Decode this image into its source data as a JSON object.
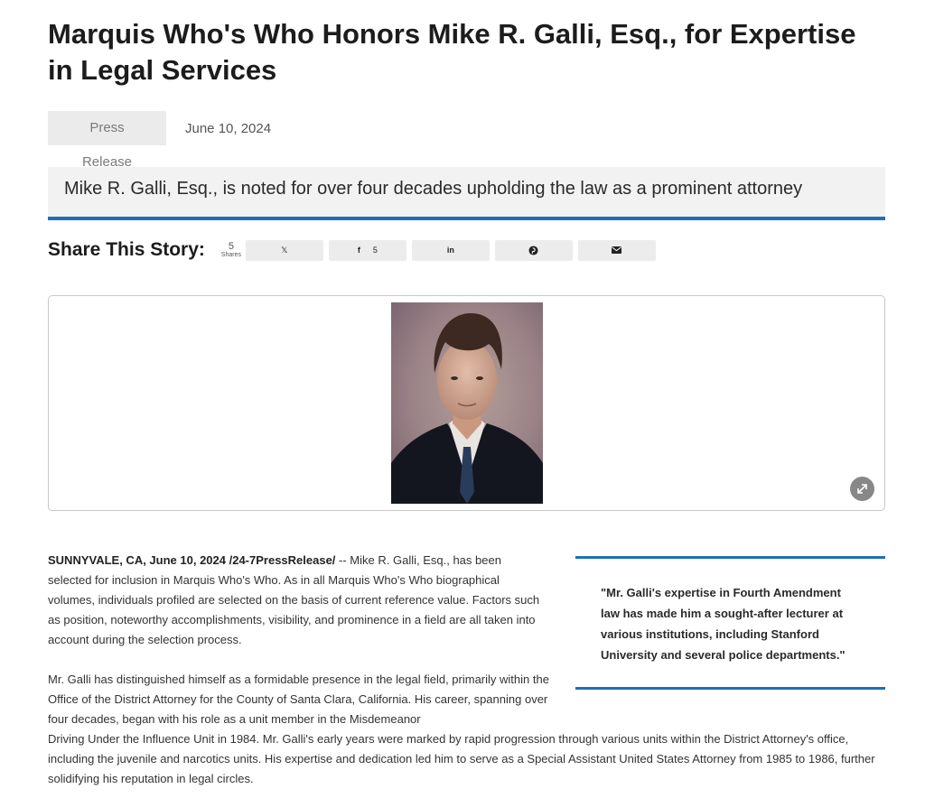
{
  "article": {
    "title": "Marquis Who's Who Honors Mike R. Galli, Esq., for Expertise in Legal Services",
    "category": "Press Release",
    "date": "June 10, 2024",
    "subtitle": "Mike R. Galli, Esq., is noted for over four decades upholding the law as a prominent attorney"
  },
  "share": {
    "heading": "Share This Story:",
    "count": "5",
    "count_label": "Shares",
    "buttons": [
      {
        "icon": "x-icon",
        "label": "𝕏",
        "count": ""
      },
      {
        "icon": "facebook-icon",
        "label": "f",
        "count": "5"
      },
      {
        "icon": "linkedin-icon",
        "label": "in",
        "count": ""
      },
      {
        "icon": "pinterest-icon",
        "label": "",
        "count": ""
      },
      {
        "icon": "email-icon",
        "label": "",
        "count": ""
      }
    ]
  },
  "figure": {
    "image": "portrait-photo",
    "expand_icon": "expand-icon"
  },
  "body": {
    "dateline": "SUNNYVALE, CA, June 10, 2024 /24-7PressRelease/",
    "p1": " -- Mike R. Galli, Esq., has been selected for inclusion in Marquis Who's Who. As in all Marquis Who's Who biographical volumes, individuals profiled are selected on the basis of current reference value. Factors such as position, noteworthy accomplishments, visibility, and prominence in a field are all taken into account during the selection process.",
    "p2_part1": "Mr. Galli has distinguished himself as a formidable presence in the legal field, primarily within the Office of the District Attorney for the County of Santa Clara, California. His career, spanning over four decades, began with his role as a unit member in the Misdemeanor",
    "p2_part2": "Driving Under the Influence Unit in 1984. Mr. Galli's early years were marked by rapid progression through various units within the District Attorney's office, including the juvenile and narcotics units. His expertise and dedication led him to serve as a Special Assistant United States Attorney from 1985 to 1986, further solidifying his reputation in legal circles."
  },
  "pull_quote": {
    "text": "\"Mr. Galli's expertise in Fourth Amendment law has made him a sought-after lecturer at various institutions, including Stanford University and several police departments.\""
  },
  "colors": {
    "accent": "#1f6fb7",
    "tag_bg": "#ebebeb",
    "button_bg": "#ececec"
  }
}
